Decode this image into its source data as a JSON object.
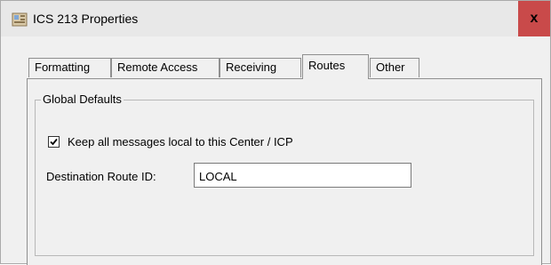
{
  "window": {
    "title": "ICS 213 Properties",
    "icon": "ics-app-icon",
    "close_label": "x",
    "close_color": "#c94a4a"
  },
  "tabs": [
    {
      "label": "Formatting",
      "active": false
    },
    {
      "label": "Remote Access",
      "active": false
    },
    {
      "label": "Receiving",
      "active": false
    },
    {
      "label": "Routes",
      "active": true
    },
    {
      "label": "Other",
      "active": false
    }
  ],
  "global_defaults": {
    "legend": "Global Defaults",
    "keep_local": {
      "label": "Keep all messages local to this Center / ICP",
      "checked": true
    },
    "destination_route": {
      "label": "Destination Route ID:",
      "value": "LOCAL"
    }
  }
}
